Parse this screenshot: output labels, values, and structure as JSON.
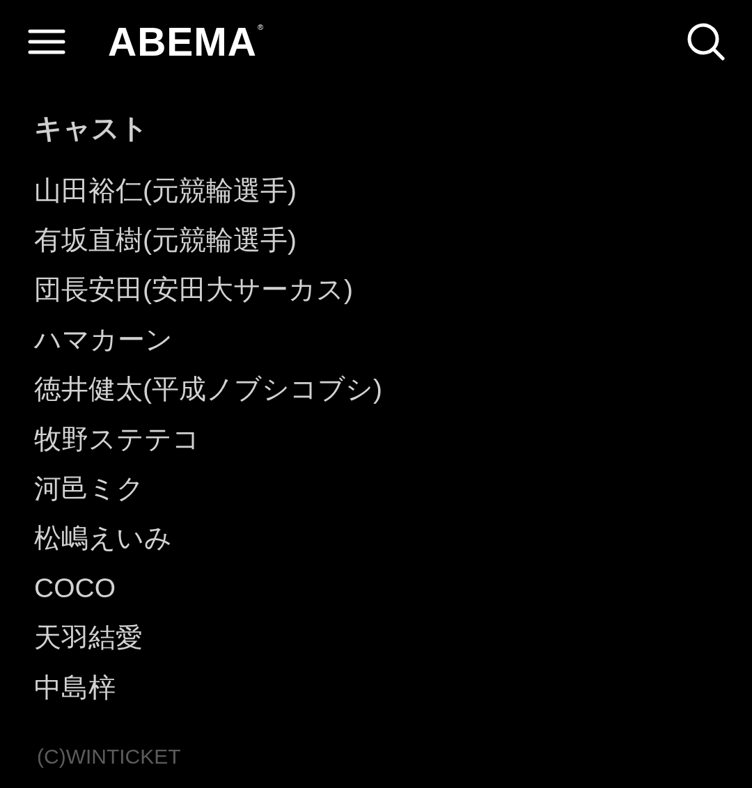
{
  "header": {
    "logo": {
      "text": "ABEMA",
      "mark": "®"
    }
  },
  "cast_section": {
    "title": "キャスト",
    "members": [
      "山田裕仁(元競輪選手)",
      "有坂直樹(元競輪選手)",
      "団長安田(安田大サーカス)",
      "ハマカーン",
      "徳井健太(平成ノブシコブシ)",
      "牧野ステテコ",
      "河邑ミク",
      "松嶋えいみ",
      "COCO",
      "天羽結愛",
      "中島梓"
    ]
  },
  "copyright": "(C)WINTICKET"
}
